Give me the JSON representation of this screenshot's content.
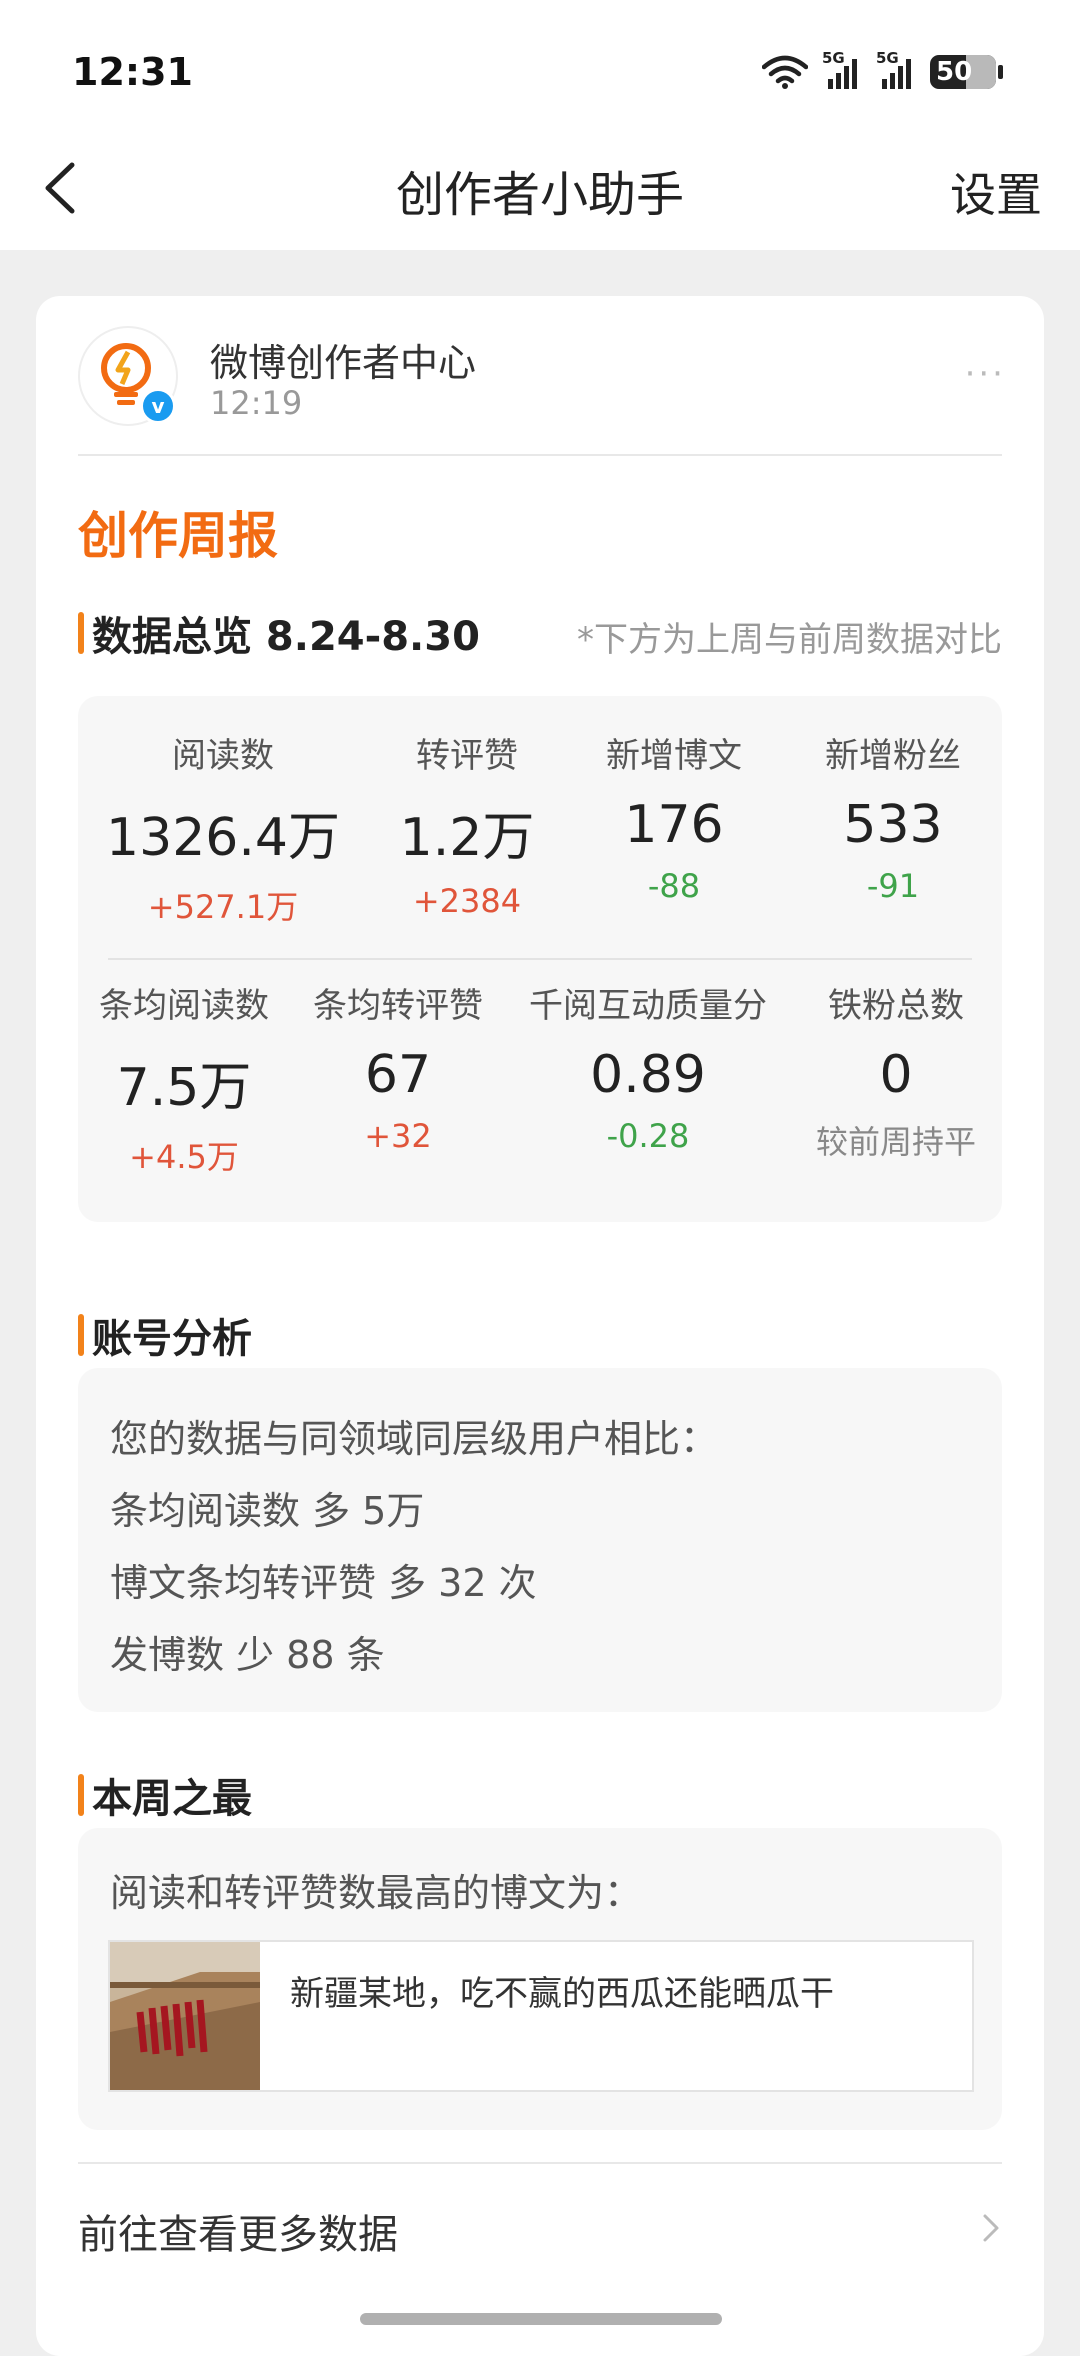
{
  "status_bar": {
    "time": "12:31",
    "network1": "5G",
    "network2": "5G",
    "battery": "50",
    "icons": [
      "wifi-icon",
      "signal-5g-icon",
      "signal-5g-icon",
      "battery-icon"
    ]
  },
  "nav": {
    "title": "创作者小助手",
    "settings": "设置",
    "back_icon": "chevron-left-icon"
  },
  "message": {
    "sender": "微博创作者中心",
    "time": "12:19",
    "avatar_icon": "lightbulb-lightning-icon",
    "verified_label": "v",
    "more": "···"
  },
  "report": {
    "title": "创作周报",
    "overview": {
      "title": "数据总览 8.24-8.30",
      "note": "*下方为上周与前周数据对比",
      "stats": [
        {
          "label": "阅读数",
          "value": "1326.4万",
          "delta": "+527.1万",
          "trend": "up"
        },
        {
          "label": "转评赞",
          "value": "1.2万",
          "delta": "+2384",
          "trend": "up"
        },
        {
          "label": "新增博文",
          "value": "176",
          "delta": "-88",
          "trend": "down"
        },
        {
          "label": "新增粉丝",
          "value": "533",
          "delta": "-91",
          "trend": "down"
        },
        {
          "label": "条均阅读数",
          "value": "7.5万",
          "delta": "+4.5万",
          "trend": "up"
        },
        {
          "label": "条均转评赞",
          "value": "67",
          "delta": "+32",
          "trend": "up"
        },
        {
          "label": "千阅互动质量分",
          "value": "0.89",
          "delta": "-0.28",
          "trend": "down"
        },
        {
          "label": "铁粉总数",
          "value": "0",
          "delta": "较前周持平",
          "trend": "flat"
        }
      ]
    },
    "account_analysis": {
      "title": "账号分析",
      "lines": [
        "您的数据与同领域同层级用户相比：",
        "条均阅读数 多 5万",
        "博文条均转评赞 多 32 次",
        "发博数 少 88 条"
      ]
    },
    "best_of_week": {
      "title": "本周之最",
      "intro": "阅读和转评赞数最高的博文为：",
      "post_title": "新疆某地，吃不赢的西瓜还能晒瓜干"
    },
    "more_link": "前往查看更多数据"
  },
  "colors": {
    "accent_orange": "#f26b12",
    "section_bar": "#f2821a",
    "up": "#e0553a",
    "down": "#3fa34a",
    "flat": "#888888",
    "verified": "#1a9bf0"
  }
}
